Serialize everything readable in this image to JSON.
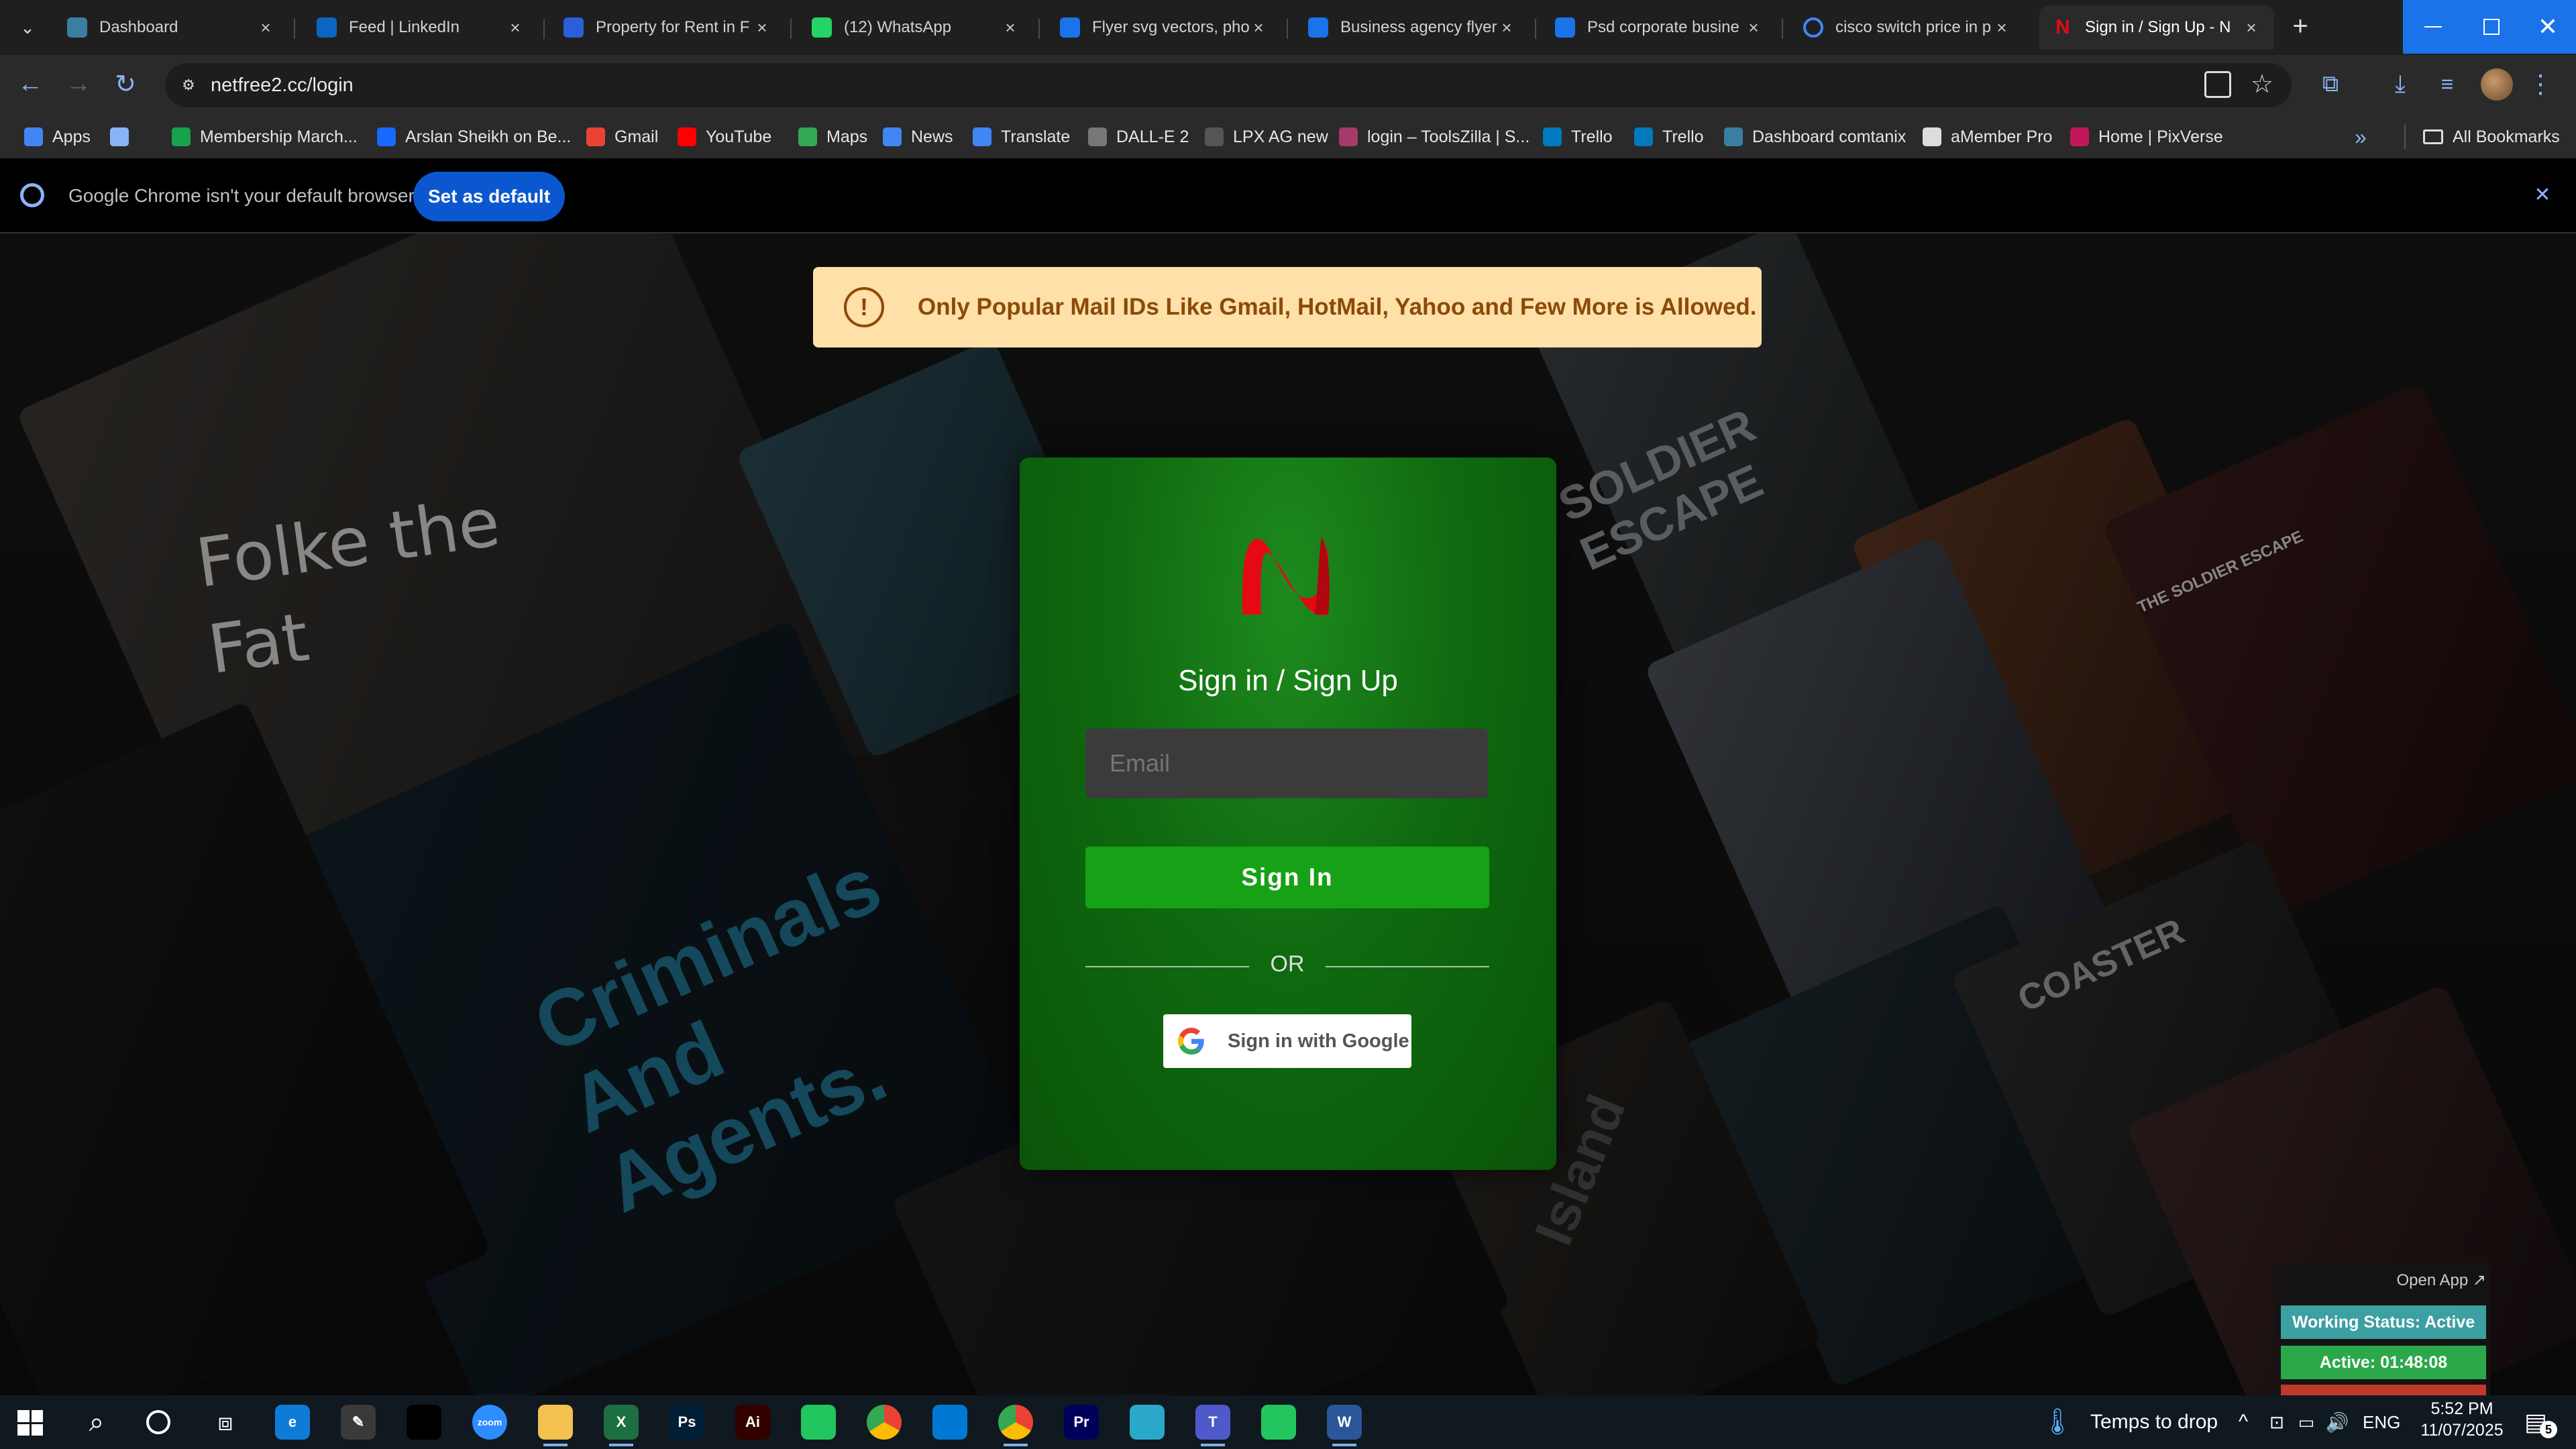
{
  "browser": {
    "tabs": [
      {
        "title": "Dashboard",
        "icon": "dashboard-icon",
        "color": "#3b7ea1",
        "active": false
      },
      {
        "title": "Feed | LinkedIn",
        "icon": "linkedin-icon",
        "color": "#0a66c2",
        "active": false
      },
      {
        "title": "Property for Rent in F",
        "icon": "property-icon",
        "color": "#2b5fd9",
        "active": false
      },
      {
        "title": "(12) WhatsApp",
        "icon": "whatsapp-icon",
        "color": "#25d366",
        "active": false
      },
      {
        "title": "Flyer svg vectors, pho",
        "icon": "flyer-icon",
        "color": "#1a73e8",
        "active": false
      },
      {
        "title": "Business agency flyer",
        "icon": "flyer-icon",
        "color": "#1a73e8",
        "active": false
      },
      {
        "title": "Psd corporate busine",
        "icon": "flyer-icon",
        "color": "#1a73e8",
        "active": false
      },
      {
        "title": "cisco switch price in p",
        "icon": "google-icon",
        "color": "#ffffff",
        "active": false
      },
      {
        "title": "Sign in / Sign Up - N",
        "icon": "netfree-icon",
        "color": "#e50914",
        "active": true
      }
    ],
    "new_tab_label": "+",
    "url": "netfree2.cc/login",
    "bookmarks": [
      {
        "label": "Apps",
        "icon": "apps-icon",
        "color": "#4285f4"
      },
      {
        "label": "",
        "icon": "grid-icon",
        "color": "#8ab4f8"
      },
      {
        "label": "Membership March...",
        "icon": "plus-icon",
        "color": "#16a34a"
      },
      {
        "label": "Arslan Sheikh on Be...",
        "icon": "behance-icon",
        "color": "#1769ff"
      },
      {
        "label": "Gmail",
        "icon": "gmail-icon",
        "color": "#ea4335"
      },
      {
        "label": "YouTube",
        "icon": "youtube-icon",
        "color": "#ff0000"
      },
      {
        "label": "Maps",
        "icon": "maps-icon",
        "color": "#34a853"
      },
      {
        "label": "News",
        "icon": "news-icon",
        "color": "#4285f4"
      },
      {
        "label": "Translate",
        "icon": "translate-icon",
        "color": "#4285f4"
      },
      {
        "label": "DALL-E 2",
        "icon": "openai-icon",
        "color": "#777777"
      },
      {
        "label": "LPX AG new",
        "icon": "dash-icon",
        "color": "#555555"
      },
      {
        "label": "login – ToolsZilla | S...",
        "icon": "toolszilla-icon",
        "color": "#a43b6b"
      },
      {
        "label": "Trello",
        "icon": "trello-icon",
        "color": "#0079bf"
      },
      {
        "label": "Trello",
        "icon": "trello-icon",
        "color": "#0079bf"
      },
      {
        "label": "Dashboard comtanix",
        "icon": "dashboard-icon",
        "color": "#3b7ea1"
      },
      {
        "label": "aMember Pro",
        "icon": "amember-icon",
        "color": "#dddddd"
      },
      {
        "label": "Home | PixVerse",
        "icon": "pixverse-icon",
        "color": "#c2185b"
      }
    ],
    "more_bookmarks": "»",
    "all_bookmarks": "All Bookmarks"
  },
  "infobar": {
    "message": "Google Chrome isn't your default browser",
    "button": "Set as default",
    "close": "✕"
  },
  "alert": {
    "icon": "!",
    "message": "Only Popular Mail IDs Like Gmail, HotMail, Yahoo and Few More is Allowed."
  },
  "login": {
    "logo": "N",
    "title": "Sign in / Sign Up",
    "email_placeholder": "Email",
    "sign_in": "Sign In",
    "or": "OR",
    "google": "Sign in with Google"
  },
  "posters": {
    "folke": "Folke the Fat",
    "criminals": "Criminals And Agents.",
    "soldier": "SOLDIER ESCAPE",
    "soldier2": "THE SOLDIER ESCAPE",
    "coaster": "COASTER",
    "island": "Island"
  },
  "widget": {
    "open_app": "Open App ↗",
    "status": "Working Status: Active",
    "active_time": "Active: 01:48:08"
  },
  "taskbar": {
    "apps": [
      {
        "name": "edge-icon",
        "label": "e",
        "color": "#0f7bd8"
      },
      {
        "name": "pen-icon",
        "label": "✎",
        "color": "#3a3a3a"
      },
      {
        "name": "terminal-icon",
        "label": "",
        "color": "#000000"
      },
      {
        "name": "zoom-icon",
        "label": "zoom",
        "color": "#2d8cff"
      },
      {
        "name": "file-explorer-icon",
        "label": "",
        "color": "#f2c14e"
      },
      {
        "name": "excel-icon",
        "label": "X",
        "color": "#1d6f42"
      },
      {
        "name": "photoshop-icon",
        "label": "Ps",
        "color": "#001e36"
      },
      {
        "name": "illustrator-icon",
        "label": "Ai",
        "color": "#330000"
      },
      {
        "name": "green-app-icon",
        "label": "",
        "color": "#22c55e"
      },
      {
        "name": "chrome-icon",
        "label": "",
        "color": "#fbbc04"
      },
      {
        "name": "vscode-icon",
        "label": "",
        "color": "#0078d4"
      },
      {
        "name": "chrome-active-icon",
        "label": "",
        "color": "#ea4335"
      },
      {
        "name": "premiere-icon",
        "label": "Pr",
        "color": "#00005b"
      },
      {
        "name": "app-icon",
        "label": "",
        "color": "#2aa8c9"
      },
      {
        "name": "teams-icon",
        "label": "T",
        "color": "#5059c9"
      },
      {
        "name": "green-app-icon-2",
        "label": "",
        "color": "#22c55e"
      },
      {
        "name": "word-icon",
        "label": "W",
        "color": "#2b579a"
      }
    ],
    "weather": "Temps to drop",
    "lang": "ENG",
    "time": "5:52 PM",
    "date": "11/07/2025",
    "notif_count": "5"
  }
}
